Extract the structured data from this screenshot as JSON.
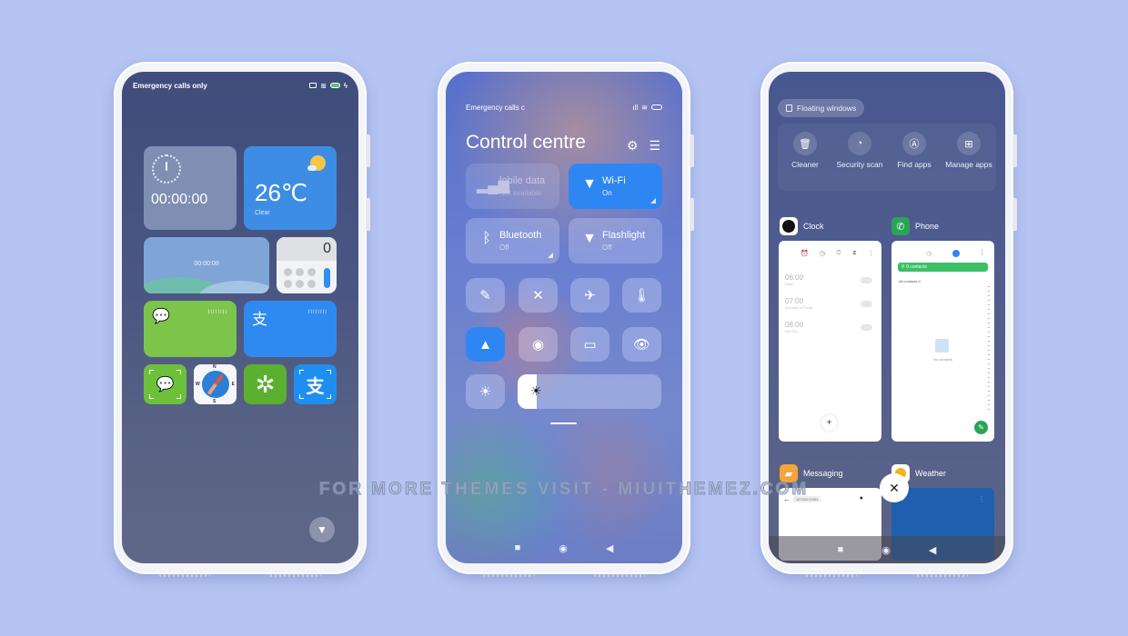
{
  "watermark": "FOR MORE THEMES VISIT - MIUITHEMEZ.COM",
  "phone1": {
    "status": {
      "carrier": "Emergency calls only",
      "icons": [
        "screenshot-icon",
        "wifi-icon",
        "battery-icon",
        "charging-icon"
      ]
    },
    "clock_widget": {
      "time": "00:00:00"
    },
    "weather_widget": {
      "temperature": "26℃",
      "condition": "Clear"
    },
    "timer_widget": {
      "time": "00:00:00"
    },
    "calculator_widget": {
      "display": "0"
    },
    "wechat_widget": {
      "bars": "IIIIIIII"
    },
    "alipay_widget": {
      "glyph": "支",
      "bars": "IIIIIIII"
    },
    "shortcuts": [
      {
        "name": "wechat-scan",
        "glyph": "💬"
      },
      {
        "name": "compass",
        "labels": [
          "N",
          "E",
          "S",
          "W"
        ]
      },
      {
        "name": "camera-shutter",
        "glyph": "✲"
      },
      {
        "name": "alipay-scan",
        "glyph": "支"
      }
    ],
    "flashlight_fab": "flashlight"
  },
  "phone2": {
    "status": {
      "carrier": "Emergency calls c"
    },
    "title": "Control centre",
    "tiles": [
      {
        "label": "Mobile data",
        "shown": "lobile data",
        "state": "Not available",
        "active": false
      },
      {
        "label": "Wi-Fi",
        "state": "On",
        "active": true
      },
      {
        "label": "Bluetooth",
        "state": "Off",
        "active": false
      },
      {
        "label": "Flashlight",
        "state": "Off",
        "active": false
      }
    ],
    "toggles": [
      {
        "name": "edit",
        "glyph": "✎",
        "active": false
      },
      {
        "name": "mute",
        "glyph": "✕",
        "active": false
      },
      {
        "name": "airplane-mode",
        "glyph": "✈",
        "active": false
      },
      {
        "name": "rotation-lock",
        "glyph": "🌡",
        "active": false
      },
      {
        "name": "location",
        "glyph": "▲",
        "active": true
      },
      {
        "name": "dnd",
        "glyph": "◉",
        "active": false
      },
      {
        "name": "screen",
        "glyph": "▭",
        "active": false
      },
      {
        "name": "reading-mode",
        "glyph": "👁",
        "active": false
      }
    ],
    "brightness": {
      "auto_icon": "☀",
      "level": 0.13,
      "icon": "☀"
    },
    "nav": [
      "■",
      "◉",
      "◀"
    ]
  },
  "phone3": {
    "floating_windows": "Floating windows",
    "tools": [
      {
        "label": "Cleaner",
        "icon": "🗑"
      },
      {
        "label": "Security scan",
        "icon": "◔"
      },
      {
        "label": "Find apps",
        "icon": "Ⓐ"
      },
      {
        "label": "Manage apps",
        "icon": "⊞"
      }
    ],
    "recents": [
      {
        "app": "Clock",
        "alarms": [
          {
            "time": "06:00",
            "repeat": "Daily"
          },
          {
            "time": "07:00",
            "repeat": "Monday to Friday"
          },
          {
            "time": "08:00",
            "repeat": "Sat Sun"
          }
        ]
      },
      {
        "app": "Phone",
        "search": "0 contacts",
        "all_contacts": "All contacts  0",
        "empty": "No contacts"
      },
      {
        "app": "Messaging",
        "recipient": "12720271001"
      },
      {
        "app": "Weather"
      }
    ],
    "close_all": "✕",
    "nav": [
      "■",
      "◉",
      "◀"
    ]
  }
}
